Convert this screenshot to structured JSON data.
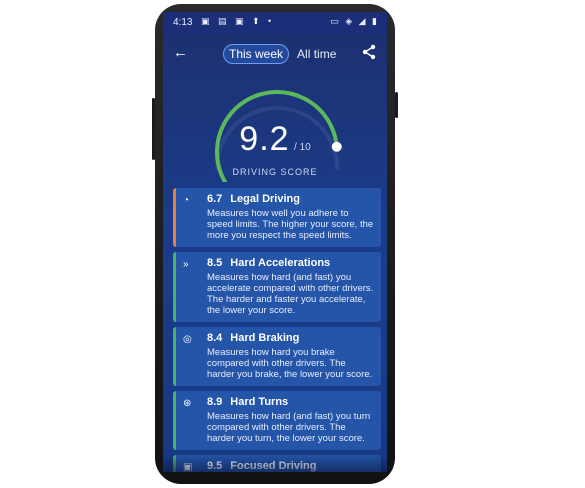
{
  "status_bar": {
    "time": "4:13",
    "left_icons": "▣ ▤ ▣ ⬆ •",
    "right_icons": "▭ ◈ ◢ ▮"
  },
  "header": {
    "tab_this_week": "This week",
    "tab_all_time": "All time"
  },
  "score": {
    "value": "9.2",
    "max": "/ 10",
    "label": "DRIVING SCORE",
    "fraction": 0.92
  },
  "colors": {
    "legal": "#e9803a",
    "good": "#49b36a",
    "gauge": "#5cb85c"
  },
  "cards": [
    {
      "score": "6.7",
      "title": "Legal Driving",
      "description": "Measures how well you adhere to speed limits. The higher your score, the more you respect the speed limits.",
      "icon": "speedometer-icon"
    },
    {
      "score": "8.5",
      "title": "Hard Accelerations",
      "description": "Measures how hard (and fast) you accelerate compared with other drivers. The harder and faster you accelerate, the lower your score.",
      "icon": "acceleration-icon"
    },
    {
      "score": "8.4",
      "title": "Hard Braking",
      "description": "Measures how hard you brake compared with other drivers. The harder you brake, the lower your score.",
      "icon": "brake-icon"
    },
    {
      "score": "8.9",
      "title": "Hard Turns",
      "description": "Measures how hard (and fast) you turn compared with other drivers. The harder you turn, the lower your score.",
      "icon": "steering-wheel-icon"
    },
    {
      "score": "9.5",
      "title": "Focused Driving",
      "description": "",
      "icon": "phone-icon"
    }
  ]
}
